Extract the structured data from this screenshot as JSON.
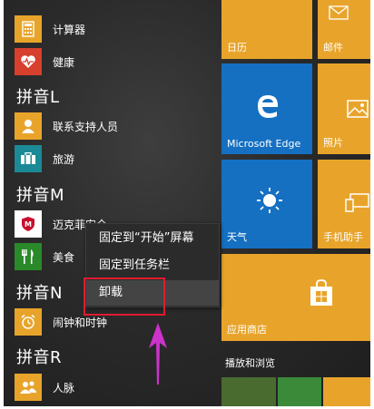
{
  "app_list": {
    "items": [
      {
        "label": "计算器",
        "icon": "calculator-icon",
        "color": "#e8a42a"
      },
      {
        "label": "健康",
        "icon": "health-heart-icon",
        "color": "#d6402c"
      },
      {
        "label": "联系支持人员",
        "icon": "contact-support-icon",
        "color": "#e8a42a"
      },
      {
        "label": "旅游",
        "icon": "suitcase-icon",
        "color": "#1b8a96"
      },
      {
        "label": "迈克菲安全",
        "icon": "mcafee-shield-icon",
        "color": "#ffffff"
      },
      {
        "label": "美食",
        "icon": "food-icon",
        "color": "#2a8a2a"
      },
      {
        "label": "闹钟和时钟",
        "icon": "alarm-clock-icon",
        "color": "#e8a42a"
      },
      {
        "label": "人脉",
        "icon": "people-icon",
        "color": "#e8a42a"
      }
    ],
    "groups": [
      "拼音L",
      "拼音M",
      "拼音N",
      "拼音R"
    ]
  },
  "tiles": {
    "calendar": "日历",
    "mail": "邮件",
    "edge": "Microsoft Edge",
    "photos": "照片",
    "weather": "天气",
    "phone": "手机助手",
    "store": "应用商店",
    "section": "播放和浏览"
  },
  "context_menu": {
    "items": [
      "固定到“开始”屏幕",
      "固定到任务栏",
      "卸载"
    ]
  },
  "colors": {
    "tile_orange": "#e8a42a",
    "tile_blue": "#1570c2",
    "menu_bg": "#2b2b2b",
    "annotation_red": "#e01b2e",
    "annotation_arrow": "#cc33cc"
  }
}
